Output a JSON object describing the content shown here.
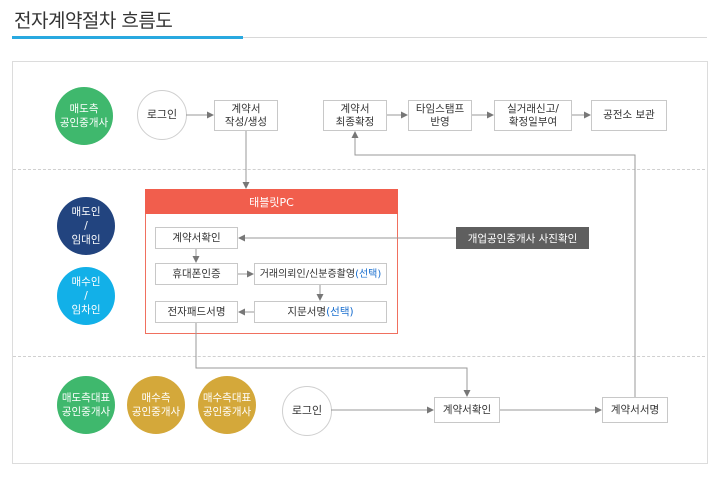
{
  "title": "전자계약절차 흐름도",
  "colors": {
    "green": "#3fb86d",
    "navy": "#22447f",
    "sky": "#12b0e8",
    "gold": "#d4a83a",
    "red": "#f15e4d",
    "accent": "#29a9e0"
  },
  "row1": {
    "actor": "매도측\n공인중개사",
    "login": "로그인",
    "draft": "계약서\n작성/생성",
    "final": "계약서\n최종확정",
    "timestamp": "타임스탬프\n반영",
    "report": "실거래신고/\n확정일부여",
    "archive": "공전소 보관"
  },
  "row2": {
    "seller": "매도인\n/\n임대인",
    "buyer": "매수인\n/\n임차인",
    "tablet_title": "태블릿PC",
    "contract_check": "계약서확인",
    "phone_auth": "휴대폰인증",
    "id_photo": "거래의뢰인/신분증촬영",
    "id_photo_opt": "(선택)",
    "fingerprint": "지문서명",
    "fingerprint_opt": "(선택)",
    "pad_sign": "전자패드서명",
    "agent_photo": "개업공인중개사 사진확인"
  },
  "row3": {
    "seller_rep": "매도측대표\n공인중개사",
    "buyer_agent": "매수측\n공인중개사",
    "buyer_rep": "매수측대표\n공인중개사",
    "login": "로그인",
    "contract_check": "계약서확인",
    "contract_sign": "계약서서명"
  }
}
